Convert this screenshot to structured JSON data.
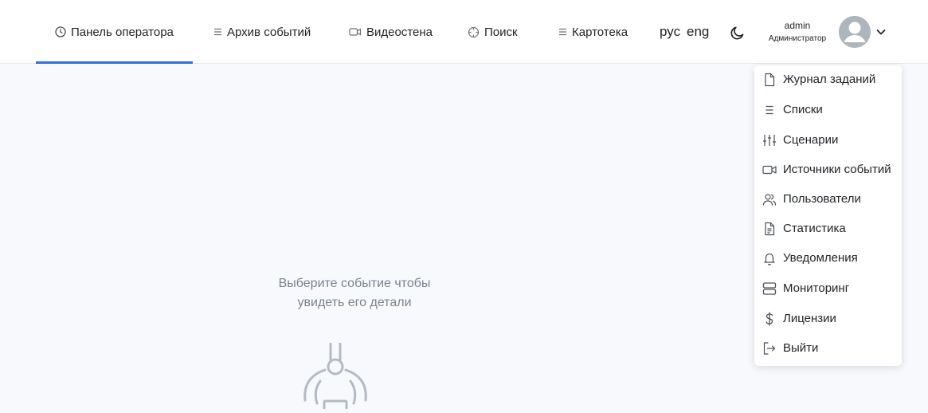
{
  "nav": [
    {
      "label": "Панель оператора",
      "icon": "clock-icon",
      "active": true
    },
    {
      "label": "Архив событий",
      "icon": "list-icon",
      "active": false
    },
    {
      "label": "Видеостена",
      "icon": "video-camera-icon",
      "active": false
    },
    {
      "label": "Поиск",
      "icon": "crosshair-icon",
      "active": false
    },
    {
      "label": "Картотека",
      "icon": "list-icon",
      "active": false
    }
  ],
  "languages": {
    "ru": "рус",
    "en": "eng"
  },
  "theme_toggle": {
    "icon": "moon-icon"
  },
  "user": {
    "name": "admin",
    "role": "Администратор",
    "avatar_icon": "user-avatar-icon",
    "menu_icon": "chevron-down-icon"
  },
  "menu": [
    {
      "label": "Журнал заданий",
      "icon": "file-icon"
    },
    {
      "label": "Списки",
      "icon": "list-icon"
    },
    {
      "label": "Сценарии",
      "icon": "sliders-icon"
    },
    {
      "label": "Источники событий",
      "icon": "video-camera-icon"
    },
    {
      "label": "Пользователи",
      "icon": "users-icon"
    },
    {
      "label": "Статистика",
      "icon": "file-text-icon"
    },
    {
      "label": "Уведомления",
      "icon": "bell-icon"
    },
    {
      "label": "Мониторинг",
      "icon": "server-icon"
    },
    {
      "label": "Лицензии",
      "icon": "dollar-icon"
    },
    {
      "label": "Выйти",
      "icon": "logout-icon"
    }
  ],
  "empty_state": {
    "line1": "Выберите событие чтобы",
    "line2": "увидеть его детали",
    "icon": "empty-state-illustration"
  },
  "colors": {
    "accent": "#2f6fdf",
    "background": "#f8f9fd",
    "muted_text": "#7a8290"
  }
}
